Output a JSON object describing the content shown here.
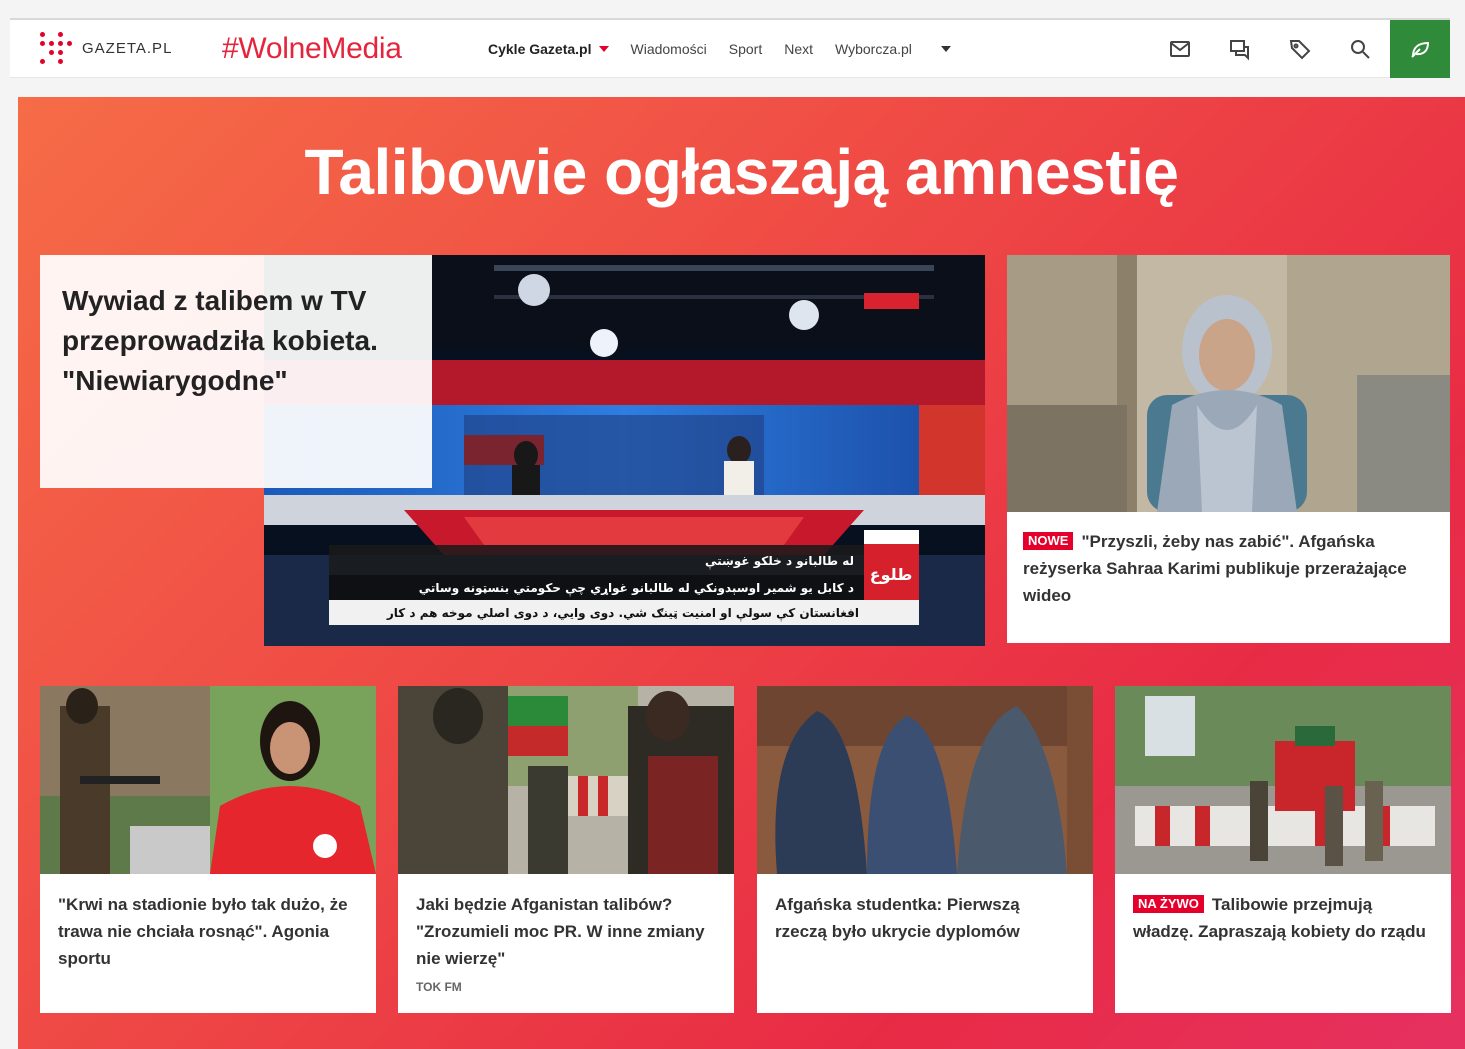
{
  "header": {
    "logo_text": "GAZETA.PL",
    "hashtag": "#WolneMedia",
    "menu": [
      {
        "label": "Cykle Gazeta.pl",
        "bold": true,
        "has_caret": true
      },
      {
        "label": "Wiadomości"
      },
      {
        "label": "Sport"
      },
      {
        "label": "Next"
      },
      {
        "label": "Wyborcza.pl"
      }
    ],
    "icons": [
      "mail-icon",
      "chat-icon",
      "tag-icon",
      "search-icon",
      "leaf-icon"
    ],
    "accent_color": "#e4002b",
    "green_color": "#2f8a3a"
  },
  "hero": {
    "title": "Talibowie ogłaszają amnestię",
    "main_story": {
      "headline": "Wywiad z talibem w TV przeprowadziła kobieta. \"Niewiarygodne\"",
      "ticker_line1": "له طالبانو د خلکو غوښتې",
      "ticker_line2": "د کابل یو شمیر اوسېدونکي له طالبانو غواړي چې حکومتي بنسټونه وساتي",
      "ticker_line3": "افغانستان کې سولې او امنیت ټینګ شي. دوی وایي، د دوی اصلي موخه هم د کار",
      "logo_text": "طلوع"
    },
    "side_story": {
      "badge": "NOWE",
      "headline": "\"Przyszli, żeby nas zabić\". Afgańska reżyserka Sahraa Karimi publikuje przerażające wideo"
    },
    "cards": [
      {
        "headline": "\"Krwi na stadionie było tak dużo, że trawa nie chciała rosnąć\". Agonia sportu"
      },
      {
        "headline": "Jaki będzie Afganistan talibów? \"Zrozumieli moc PR. W inne zmiany nie wierzę\"",
        "source": "TOK FM"
      },
      {
        "headline": "Afgańska studentka: Pierwszą rzeczą było ukrycie dyplomów"
      },
      {
        "badge": "NA ŻYWO",
        "headline": "Talibowie przejmują władzę. Zapraszają kobiety do rządu"
      }
    ]
  }
}
